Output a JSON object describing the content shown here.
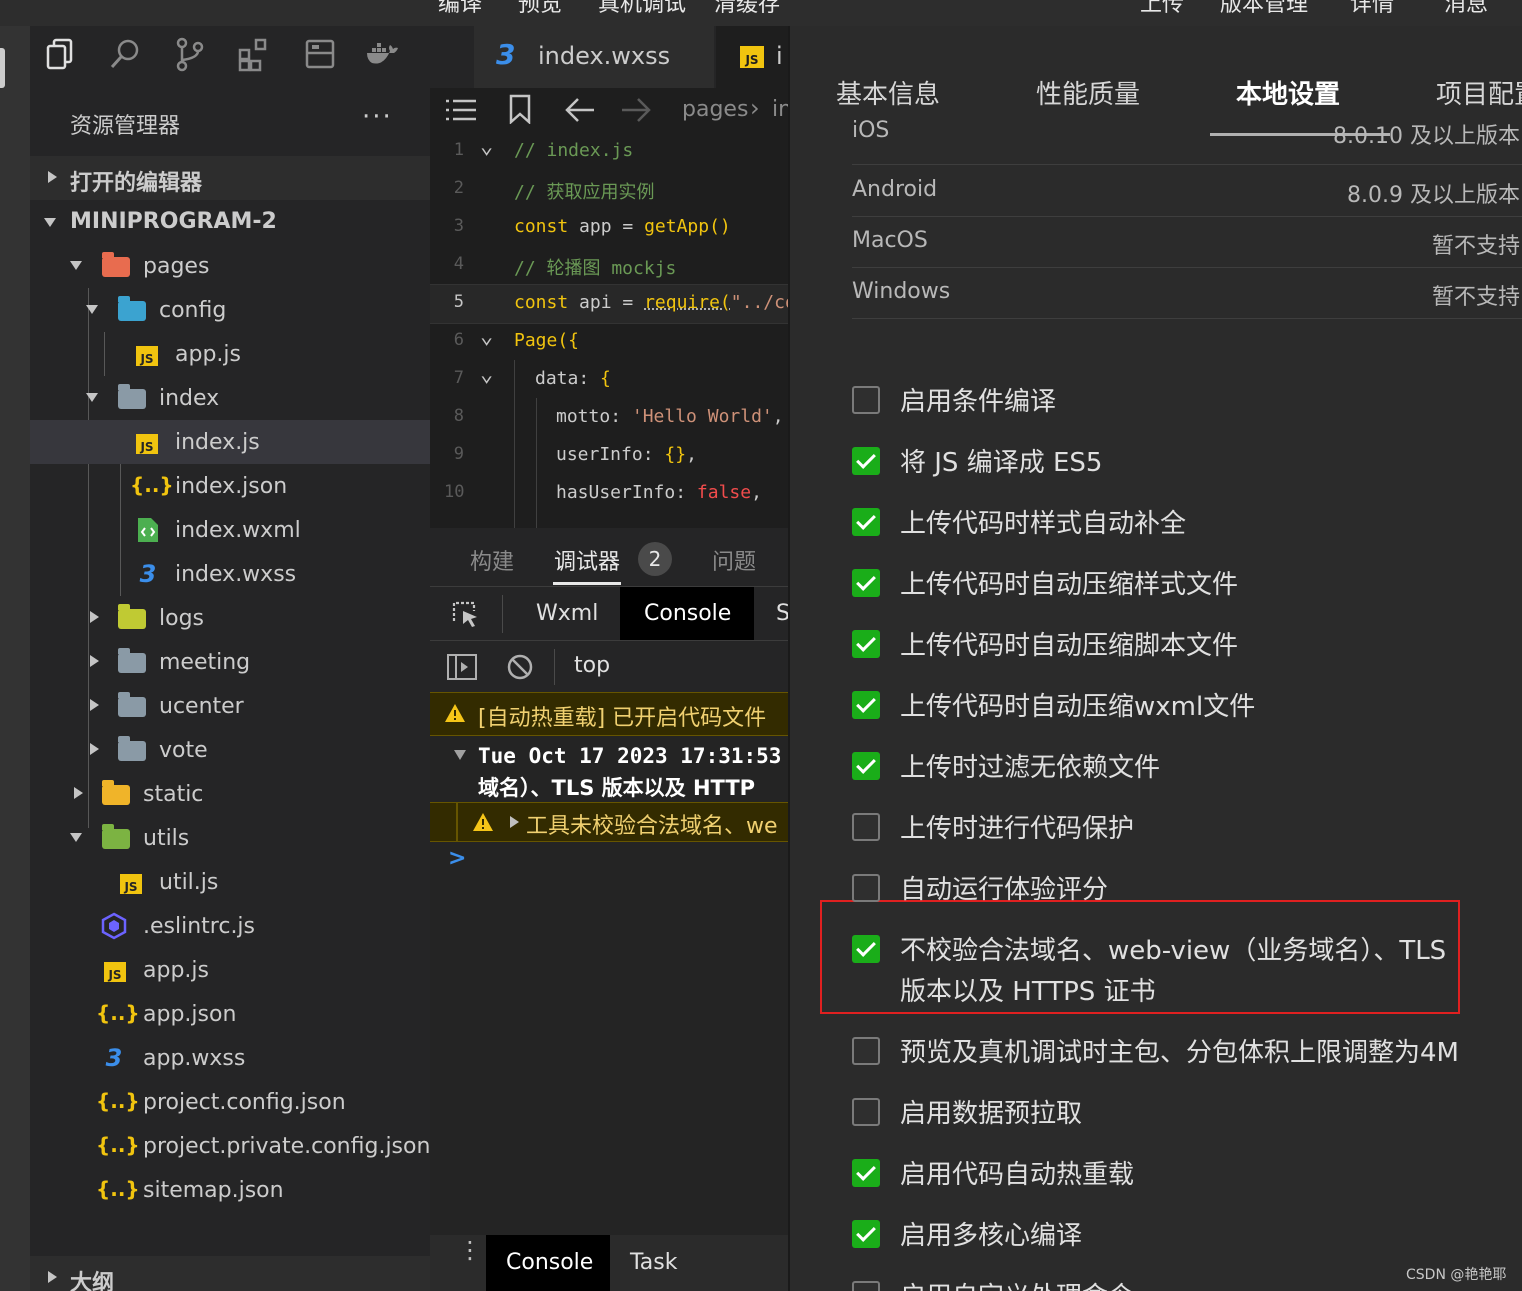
{
  "top_menu": {
    "left": [
      "编译",
      "预览",
      "真机调试",
      "清缓存"
    ],
    "right": [
      "上传",
      "版本管理",
      "详情",
      "消息"
    ]
  },
  "explorer": {
    "title": "资源管理器",
    "more": "···",
    "open_editors": "打开的编辑器",
    "project": "MINIPROGRAM-2",
    "outline": "大纲",
    "tree": {
      "pages": "pages",
      "config": "config",
      "config_app": "app.js",
      "index": "index",
      "index_js": "index.js",
      "index_json": "index.json",
      "index_wxml": "index.wxml",
      "index_wxss": "index.wxss",
      "logs": "logs",
      "meeting": "meeting",
      "ucenter": "ucenter",
      "vote": "vote",
      "static": "static",
      "utils": "utils",
      "util_js": "util.js",
      "eslintrc": ".eslintrc.js",
      "app_js": "app.js",
      "app_json": "app.json",
      "app_wxss": "app.wxss",
      "project_config": "project.config.json",
      "project_private": "project.private.config.json",
      "sitemap": "sitemap.json"
    },
    "icon_js": "JS",
    "icon_json": "{..}",
    "icon_css": "3"
  },
  "editor": {
    "tab1": "index.wxss",
    "tab2": "i",
    "breadcrumb_1": "pages",
    "breadcrumb_2": "in",
    "code": [
      {
        "n": "1",
        "parts": [
          [
            "cm",
            "// index.js"
          ]
        ]
      },
      {
        "n": "2",
        "parts": [
          [
            "cm",
            "// 获取应用实例"
          ]
        ]
      },
      {
        "n": "3",
        "parts": [
          [
            "kw",
            "const "
          ],
          [
            "id",
            "app "
          ],
          [
            "pn",
            "= "
          ],
          [
            "fn",
            "getApp()"
          ]
        ]
      },
      {
        "n": "4",
        "parts": [
          [
            "cm",
            "// 轮播图 mockjs"
          ]
        ]
      },
      {
        "n": "5",
        "parts": [
          [
            "kw",
            "const "
          ],
          [
            "id",
            "api "
          ],
          [
            "pn",
            "= "
          ],
          [
            "fn",
            "require("
          ],
          [
            "str",
            "\"../co"
          ]
        ]
      },
      {
        "n": "6",
        "parts": [
          [
            "fn",
            "Page({"
          ]
        ]
      },
      {
        "n": "7",
        "parts": [
          [
            "prop",
            "data"
          ],
          [
            "pn",
            ": "
          ],
          [
            "fn",
            "{"
          ]
        ]
      },
      {
        "n": "8",
        "parts": [
          [
            "prop",
            "motto"
          ],
          [
            "pn",
            ": "
          ],
          [
            "str",
            "'Hello World'"
          ],
          [
            "pn",
            ","
          ]
        ]
      },
      {
        "n": "9",
        "parts": [
          [
            "prop",
            "userInfo"
          ],
          [
            "pn",
            ": "
          ],
          [
            "fn",
            "{}"
          ],
          [
            "pn",
            ","
          ]
        ]
      },
      {
        "n": "10",
        "parts": [
          [
            "prop",
            "hasUserInfo"
          ],
          [
            "pn",
            ": "
          ],
          [
            "bool",
            "false"
          ],
          [
            "pn",
            ","
          ]
        ]
      }
    ]
  },
  "debug": {
    "tab_build": "构建",
    "tab_debugger": "调试器",
    "debugger_badge": "2",
    "tab_problems": "问题",
    "wxml": "Wxml",
    "console": "Console",
    "sources_initial": "S",
    "context": "top",
    "msg1": "[自动热重载] 已开启代码文件",
    "msg2_line1": "Tue Oct 17 2023 17:31:53",
    "msg2_line2": "域名）、TLS 版本以及 HTTP",
    "msg3": "工具未校验合法域名、we",
    "prompt": ">",
    "bottom_console": "Console",
    "bottom_task": "Task"
  },
  "settings": {
    "tabs": [
      "基本信息",
      "性能质量",
      "本地设置",
      "项目配置"
    ],
    "active_tab": "本地设置",
    "platforms": [
      {
        "name": "iOS",
        "value": "8.0.10 及以上版本"
      },
      {
        "name": "Android",
        "value": "8.0.9 及以上版本"
      },
      {
        "name": "MacOS",
        "value": "暂不支持"
      },
      {
        "name": "Windows",
        "value": "暂不支持"
      }
    ],
    "options": [
      {
        "label": "启用条件编译",
        "checked": false
      },
      {
        "label": "将 JS 编译成 ES5",
        "checked": true
      },
      {
        "label": "上传代码时样式自动补全",
        "checked": true
      },
      {
        "label": "上传代码时自动压缩样式文件",
        "checked": true
      },
      {
        "label": "上传代码时自动压缩脚本文件",
        "checked": true
      },
      {
        "label": "上传代码时自动压缩wxml文件",
        "checked": true
      },
      {
        "label": "上传时过滤无依赖文件",
        "checked": true
      },
      {
        "label": "上传时进行代码保护",
        "checked": false
      },
      {
        "label": "自动运行体验评分",
        "checked": false
      },
      {
        "label": "不校验合法域名、web-view（业务域名）、TLS",
        "label2": "版本以及 HTTPS 证书",
        "checked": true
      },
      {
        "label": "预览及真机调试时主包、分包体积上限调整为4M",
        "checked": false
      },
      {
        "label": "启用数据预拉取",
        "checked": false
      },
      {
        "label": "启用代码自动热重载",
        "checked": true
      },
      {
        "label": "启用多核心编译",
        "checked": true
      },
      {
        "label": "启用自定义处理命令",
        "checked": false
      }
    ],
    "highlight_color": "#e02020",
    "watermark": "CSDN @艳艳耶"
  },
  "colors": {
    "accent_green": "#1aad19",
    "js_yellow": "#f1c40f",
    "css_blue": "#3b8eea"
  }
}
